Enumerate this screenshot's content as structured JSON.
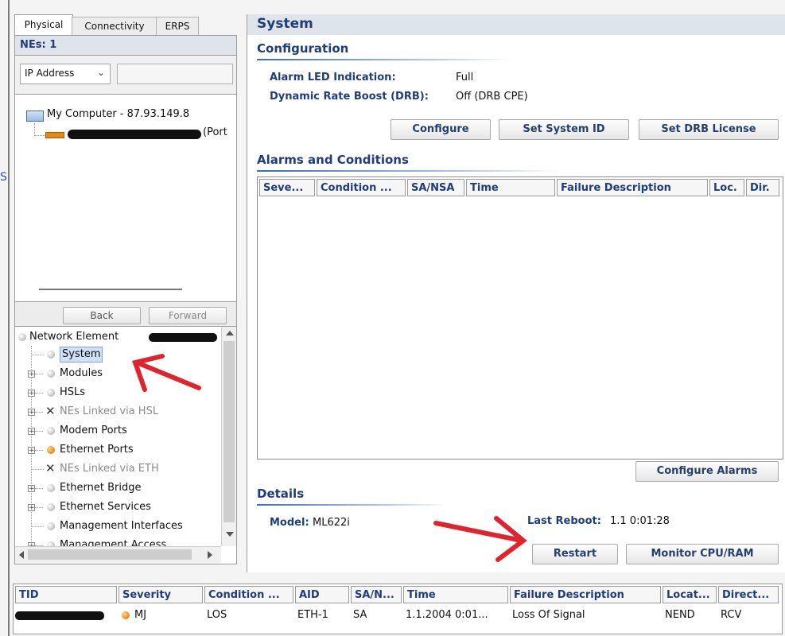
{
  "left_panel": {
    "tabs": [
      "Physical",
      "Connectivity",
      "ERPS"
    ],
    "nes_count": "NEs: 1",
    "filter_select": "IP Address",
    "filter_value": "",
    "computer_label": "My Computer - 87.93.149.8",
    "ne_port_suffix": "(Port",
    "back_label": "Back",
    "forward_label": "Forward"
  },
  "nav_tree": {
    "root": "Network Element",
    "items": [
      {
        "label": "System",
        "icon": "gray-dot-icon",
        "selected": true,
        "expandable": false,
        "disabled": false
      },
      {
        "label": "Modules",
        "icon": "gray-dot-icon",
        "expandable": true,
        "disabled": false
      },
      {
        "label": "HSLs",
        "icon": "gray-dot-icon",
        "expandable": true,
        "disabled": false
      },
      {
        "label": "NEs Linked via HSL",
        "icon": "x-mark-icon",
        "expandable": true,
        "disabled": true
      },
      {
        "label": "Modem Ports",
        "icon": "gray-dot-icon",
        "expandable": true,
        "disabled": false
      },
      {
        "label": "Ethernet Ports",
        "icon": "orange-dot-icon",
        "expandable": true,
        "disabled": false
      },
      {
        "label": "NEs Linked via ETH",
        "icon": "x-mark-icon",
        "expandable": false,
        "disabled": true
      },
      {
        "label": "Ethernet Bridge",
        "icon": "gray-dot-icon",
        "expandable": true,
        "disabled": false
      },
      {
        "label": "Ethernet Services",
        "icon": "gray-dot-icon",
        "expandable": true,
        "disabled": false
      },
      {
        "label": "Management Interfaces",
        "icon": "gray-dot-icon",
        "expandable": false,
        "disabled": false
      },
      {
        "label": "Management Access",
        "icon": "gray-dot-icon",
        "expandable": true,
        "disabled": false
      }
    ]
  },
  "main": {
    "title": "System",
    "configuration": {
      "heading": "Configuration",
      "alarm_led_label": "Alarm LED Indication:",
      "alarm_led_value": "Full",
      "drb_label": "Dynamic Rate Boost (DRB):",
      "drb_value": "Off (DRB CPE)",
      "buttons": [
        "Configure",
        "Set System ID",
        "Set DRB License"
      ]
    },
    "alarms": {
      "heading": "Alarms and Conditions",
      "columns": [
        "Seve...",
        "Condition ...",
        "SA/NSA",
        "Time",
        "Failure Description",
        "Loc.",
        "Dir."
      ],
      "rows": [],
      "configure_button": "Configure Alarms"
    },
    "details": {
      "heading": "Details",
      "model_label": "Model:",
      "model_value": "ML622i",
      "reboot_label": "Last Reboot:",
      "reboot_value": "1.1 0:01:28",
      "buttons": [
        "Restart",
        "Monitor CPU/RAM"
      ]
    }
  },
  "bottom_grid": {
    "columns": [
      "TID",
      "Severity",
      "Condition ...",
      "AID",
      "SA/N...",
      "Time",
      "Failure Description",
      "Locat...",
      "Direct..."
    ],
    "rows": [
      {
        "tid": "",
        "severity": "MJ",
        "condition": "LOS",
        "aid": "ETH-1",
        "sa": "SA",
        "time": "1.1.2004 0:01...",
        "failure": "Loss Of Signal",
        "location": "NEND",
        "direction": "RCV"
      }
    ]
  },
  "colors": {
    "accent": "#1f3d7a",
    "annotation_arrow": "#e0242d",
    "severity_major": "#f19622"
  }
}
